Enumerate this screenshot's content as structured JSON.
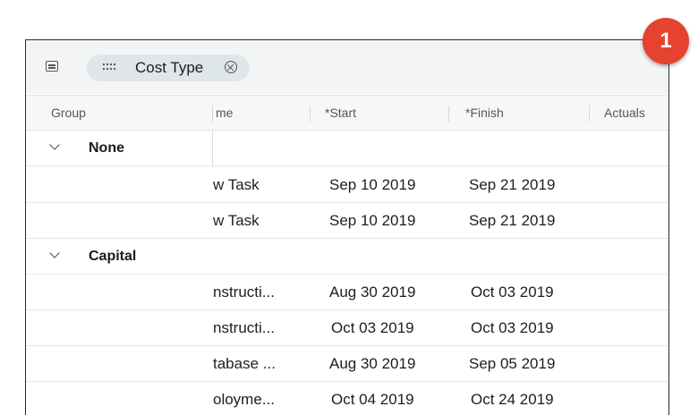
{
  "toolbar": {
    "group_panel_icon": "list-icon",
    "chip": {
      "grip_icon": "grip-icon",
      "label": "Cost Type",
      "remove_icon": "close-circle-icon"
    }
  },
  "columns": {
    "group": "Group",
    "name": "me",
    "start": "*Start",
    "finish": "*Finish",
    "actuals": "Actuals"
  },
  "groups": [
    {
      "label": "None",
      "rows": [
        {
          "name": "w Task",
          "start": "Sep 10 2019",
          "finish": "Sep 21 2019"
        },
        {
          "name": "w Task",
          "start": "Sep 10 2019",
          "finish": "Sep 21 2019"
        }
      ]
    },
    {
      "label": "Capital",
      "rows": [
        {
          "name": "nstructi...",
          "start": "Aug 30 2019",
          "finish": "Oct 03 2019"
        },
        {
          "name": "nstructi...",
          "start": "Oct 03 2019",
          "finish": "Oct 03 2019"
        },
        {
          "name": "tabase ...",
          "start": "Aug 30 2019",
          "finish": "Sep 05 2019"
        },
        {
          "name": "oloyme...",
          "start": "Oct 04 2019",
          "finish": "Oct 24 2019"
        }
      ]
    }
  ],
  "badge": {
    "number": "1",
    "color": "#e5432f"
  }
}
